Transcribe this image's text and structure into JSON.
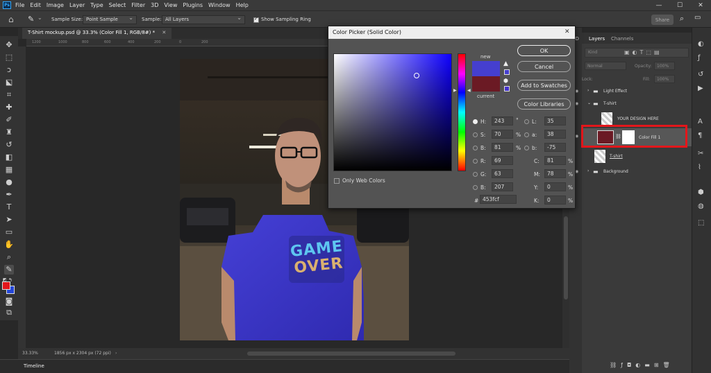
{
  "menu": [
    "File",
    "Edit",
    "Image",
    "Layer",
    "Type",
    "Select",
    "Filter",
    "3D",
    "View",
    "Plugins",
    "Window",
    "Help"
  ],
  "window_controls": {
    "minimize": "—",
    "maximize": "☐",
    "close": "✕"
  },
  "options_bar": {
    "sample_size_label": "Sample Size:",
    "sample_size_value": "Point Sample",
    "sample_label": "Sample:",
    "sample_value": "All Layers",
    "show_ring_label": "Show Sampling Ring",
    "share_label": "Share"
  },
  "document": {
    "tab_title": "T-Shirt mockup.psd @ 33.3% (Color Fill 1, RGB/8#) *",
    "ruler_ticks": [
      "1200",
      "1000",
      "800",
      "600",
      "400",
      "200",
      "0",
      "200"
    ],
    "zoom": "33.33%",
    "size_info": "1856 px x 2304 px (72 ppi)",
    "timeline_label": "Timeline"
  },
  "tshirt_print": {
    "line1": "GAME",
    "line2": "OVER"
  },
  "dialog": {
    "title": "Color Picker (Solid Color)",
    "close": "✕",
    "new_label": "new",
    "current_label": "current",
    "ok": "OK",
    "cancel": "Cancel",
    "add_to_swatches": "Add to Swatches",
    "color_libraries": "Color Libraries",
    "only_web_colors": "Only Web Colors",
    "hsb": {
      "h": "243",
      "s": "70",
      "b": "81",
      "h_unit": "°",
      "s_unit": "%",
      "b_unit": "%"
    },
    "rgb": {
      "r": "69",
      "g": "63",
      "b": "207"
    },
    "lab": {
      "l": "35",
      "a": "38",
      "b": "-75"
    },
    "cmyk": {
      "c": "81",
      "m": "78",
      "y": "0",
      "k": "0",
      "unit": "%"
    },
    "hex": "453fcf",
    "labels": {
      "H": "H:",
      "S": "S:",
      "B": "B:",
      "R": "R:",
      "G": "G:",
      "Bb": "B:",
      "L": "L:",
      "a": "a:",
      "b": "b:",
      "C": "C:",
      "M": "M:",
      "Y": "Y:",
      "K": "K:",
      "hash": "#"
    },
    "new_color": "#453fcf",
    "current_color": "#6b1a24"
  },
  "layers_panel": {
    "tab_layers": "Layers",
    "tab_channels": "Channels",
    "kind_label": "Kind",
    "blend_mode": "Normal",
    "opacity_label": "Opacity:",
    "opacity_value": "100%",
    "lock_label": "Lock:",
    "fill_label": "Fill:",
    "fill_value": "100%",
    "layers": [
      {
        "name": "Light Effect"
      },
      {
        "name": "T-shirt"
      },
      {
        "name": "YOUR DESIGN HERE"
      },
      {
        "name": "Color Fill 1"
      },
      {
        "name": "T-shirt"
      },
      {
        "name": "Background"
      }
    ]
  },
  "colors": {
    "accent_highlight": "#e3161b",
    "foreground": "#e3161b",
    "background": "#2446d8"
  }
}
